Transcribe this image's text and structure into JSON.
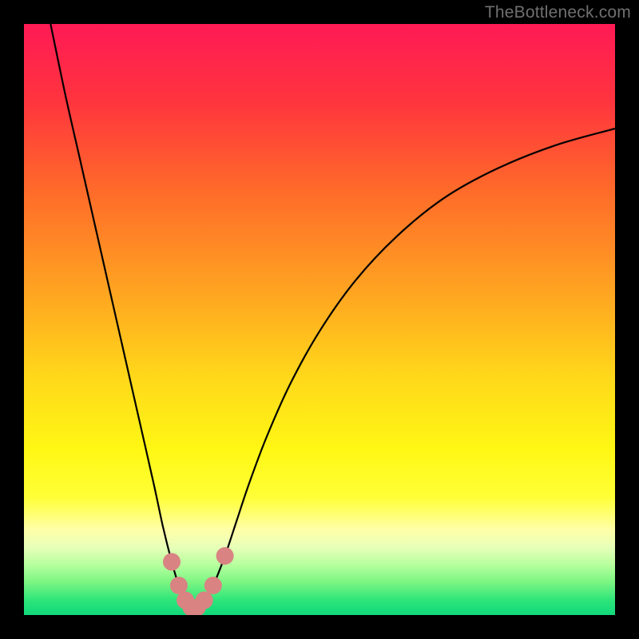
{
  "watermark": "TheBottleneck.com",
  "chart_data": {
    "type": "line",
    "title": "",
    "xlabel": "",
    "ylabel": "",
    "xlim": [
      0,
      100
    ],
    "ylim": [
      0,
      100
    ],
    "gradient_stops": [
      {
        "offset": 0.0,
        "color": "#ff1a55"
      },
      {
        "offset": 0.13,
        "color": "#ff343e"
      },
      {
        "offset": 0.28,
        "color": "#ff6a2a"
      },
      {
        "offset": 0.45,
        "color": "#ffa321"
      },
      {
        "offset": 0.6,
        "color": "#ffd91a"
      },
      {
        "offset": 0.72,
        "color": "#fff714"
      },
      {
        "offset": 0.8,
        "color": "#ffff36"
      },
      {
        "offset": 0.855,
        "color": "#ffffa8"
      },
      {
        "offset": 0.885,
        "color": "#e8ffb8"
      },
      {
        "offset": 0.915,
        "color": "#b6ff9e"
      },
      {
        "offset": 0.945,
        "color": "#7af582"
      },
      {
        "offset": 0.975,
        "color": "#2de57a"
      },
      {
        "offset": 1.0,
        "color": "#11d97a"
      }
    ],
    "series": [
      {
        "name": "bottleneck-curve",
        "x": [
          4.5,
          7.0,
          9.5,
          12.0,
          14.5,
          17.0,
          19.5,
          22.0,
          23.5,
          25.0,
          26.2,
          27.3,
          28.3,
          29.3,
          30.5,
          32.0,
          34.0,
          36.0,
          38.0,
          41.0,
          45.0,
          50.0,
          56.0,
          63.0,
          71.0,
          80.0,
          90.0,
          100.0
        ],
        "y": [
          100.0,
          88.0,
          77.0,
          66.0,
          55.0,
          44.0,
          33.0,
          22.0,
          15.0,
          9.0,
          5.0,
          2.5,
          1.3,
          1.3,
          2.5,
          5.0,
          10.0,
          16.0,
          22.0,
          30.0,
          39.0,
          48.0,
          56.5,
          64.0,
          70.5,
          75.5,
          79.5,
          82.3
        ]
      }
    ],
    "markers": {
      "name": "highlighted-range",
      "color": "#d98383",
      "points": [
        {
          "x": 25.0,
          "y": 9.0
        },
        {
          "x": 26.2,
          "y": 5.0
        },
        {
          "x": 27.3,
          "y": 2.5
        },
        {
          "x": 28.3,
          "y": 1.3
        },
        {
          "x": 29.3,
          "y": 1.3
        },
        {
          "x": 30.5,
          "y": 2.5
        },
        {
          "x": 32.0,
          "y": 5.0
        },
        {
          "x": 34.0,
          "y": 10.0
        }
      ]
    }
  }
}
